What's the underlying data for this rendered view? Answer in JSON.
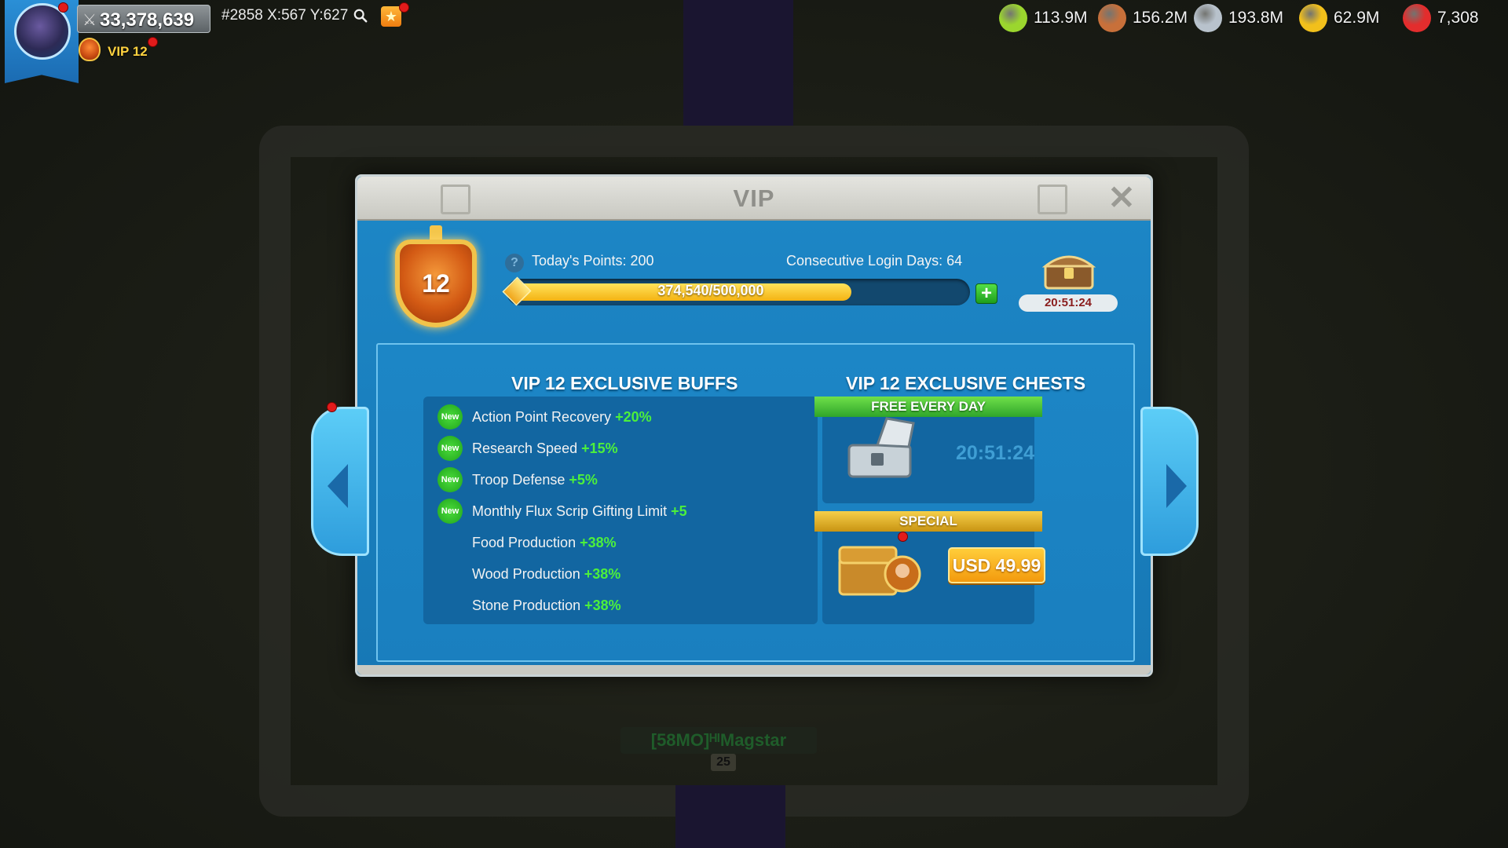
{
  "hud": {
    "power": "33,378,639",
    "coords": "#2858 X:567 Y:627",
    "vip_label": "VIP 12",
    "resources": [
      {
        "name": "food",
        "icon": "corn-icon",
        "value": "113.9M",
        "color": "#9bd62e"
      },
      {
        "name": "wood",
        "icon": "log-icon",
        "value": "156.2M",
        "color": "#c8703a"
      },
      {
        "name": "stone",
        "icon": "stone-icon",
        "value": "193.8M",
        "color": "#b8c2cc"
      },
      {
        "name": "gold",
        "icon": "gold-coin-icon",
        "value": "62.9M",
        "color": "#f2c01b"
      },
      {
        "name": "gems",
        "icon": "gem-icon",
        "value": "7,308",
        "color": "#e32d2d"
      }
    ]
  },
  "vip": {
    "title": "VIP",
    "level": "12",
    "todays_points": "Today's Points: 200",
    "login_days": "Consecutive Login Days: 64",
    "progress_text": "374,540/500,000",
    "progress_fraction": 0.749,
    "top_chest_timer": "20:51:24"
  },
  "buffs": {
    "title": "VIP 12 EXCLUSIVE BUFFS",
    "new_badge": "New",
    "items": [
      {
        "label": "Action Point Recovery",
        "value": "+20%",
        "is_new": true
      },
      {
        "label": "Research Speed",
        "value": "+15%",
        "is_new": true
      },
      {
        "label": "Troop Defense",
        "value": "+5%",
        "is_new": true
      },
      {
        "label": "Monthly Flux Scrip Gifting Limit",
        "value": "+5",
        "is_new": true
      },
      {
        "label": "Food Production",
        "value": "+38%",
        "is_new": false
      },
      {
        "label": "Wood Production",
        "value": "+38%",
        "is_new": false
      },
      {
        "label": "Stone Production",
        "value": "+38%",
        "is_new": false
      }
    ]
  },
  "chests": {
    "title": "VIP 12 EXCLUSIVE CHESTS",
    "free_label": "FREE EVERY DAY",
    "free_timer": "20:51:24",
    "special_label": "SPECIAL",
    "special_price": "USD 49.99"
  },
  "background": {
    "player_name": "[58MO]ᴴᴵMagstar",
    "player_level": "25"
  }
}
